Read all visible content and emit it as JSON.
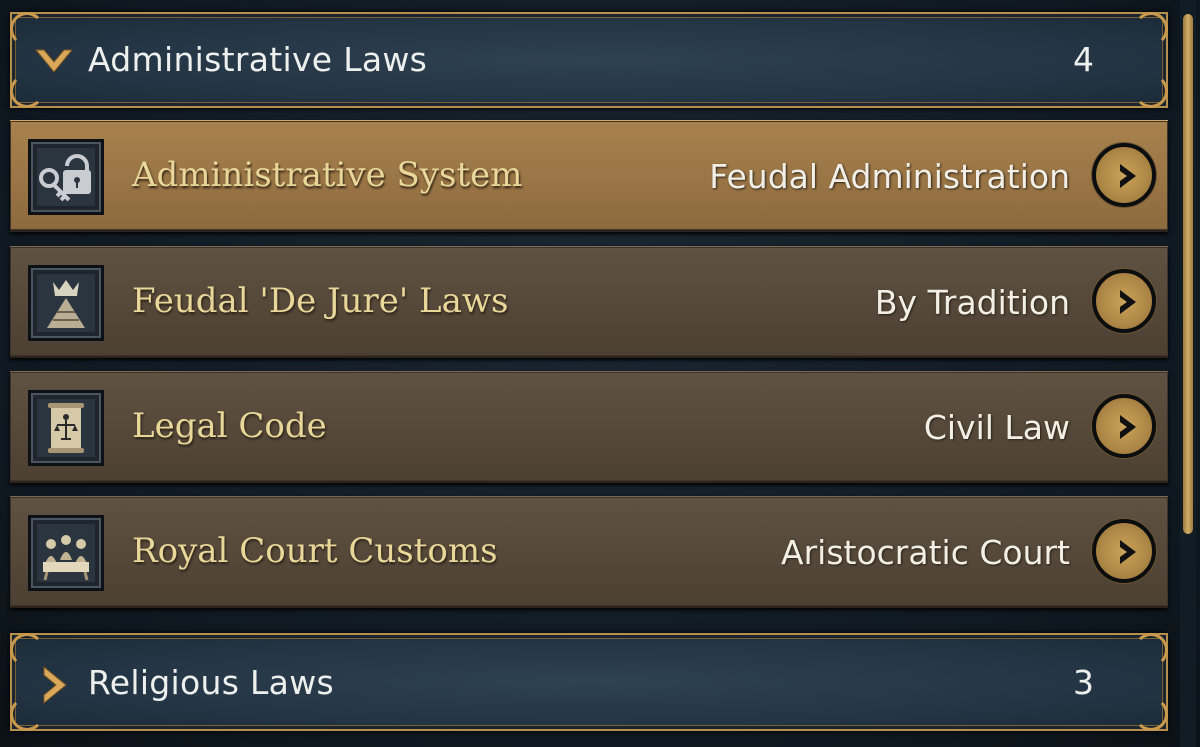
{
  "categories": [
    {
      "title": "Administrative Laws",
      "count": "4",
      "expanded": true
    },
    {
      "title": "Religious Laws",
      "count": "3",
      "expanded": false
    }
  ],
  "laws": [
    {
      "name": "Administrative System",
      "value": "Feudal Administration",
      "icon": "lock-key-icon",
      "selected": true
    },
    {
      "name": "Feudal 'De Jure' Laws",
      "value": "By Tradition",
      "icon": "crown-pyramid-icon",
      "selected": false
    },
    {
      "name": "Legal Code",
      "value": "Civil Law",
      "icon": "justice-scroll-icon",
      "selected": false
    },
    {
      "name": "Royal Court Customs",
      "value": "Aristocratic Court",
      "icon": "court-gathering-icon",
      "selected": false
    }
  ],
  "colors": {
    "accent_gold": "#c99a4e",
    "header_blue": "#243545",
    "row_brown": "#56493a",
    "row_selected": "#9b7646",
    "law_name_text": "#e9d79a"
  }
}
